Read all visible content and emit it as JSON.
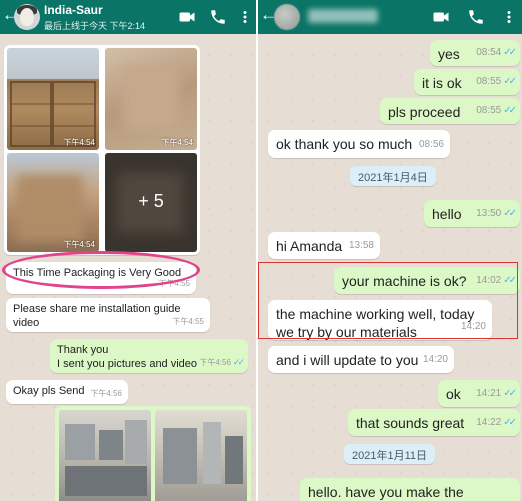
{
  "left_chat": {
    "header": {
      "back_icon": "←",
      "contact_name": "India-Saur",
      "status": "最后上线于今天 下午2:14"
    },
    "photo_album_1": {
      "times": [
        "下午4:54",
        "下午4:54",
        "下午4:54"
      ],
      "more_count": "+ 5"
    },
    "messages": [
      {
        "text": "This Time Packaging is Very Good",
        "time": "下午4:55"
      },
      {
        "text": "Please share me installation guide video",
        "time": "下午4:55"
      },
      {
        "line1": "Thank you",
        "line2": "I sent you pictures and video",
        "time": "下午4:56"
      },
      {
        "text": "Okay pls Send",
        "time": "下午4:56"
      }
    ]
  },
  "right_chat": {
    "header": {
      "back_icon": "←"
    },
    "messages": [
      {
        "text": "yes",
        "time": "08:54"
      },
      {
        "text": "it is ok",
        "time": "08:55"
      },
      {
        "text": "pls proceed",
        "time": "08:55"
      },
      {
        "text": "ok thank you so much",
        "time": "08:56"
      },
      {
        "date": "2021年1月4日"
      },
      {
        "text": "hello",
        "time": "13:50"
      },
      {
        "text": "hi Amanda",
        "time": "13:58"
      },
      {
        "text": "your machine is ok?",
        "time": "14:02"
      },
      {
        "line1": "the machine working well, today",
        "line2": "we try by our materials",
        "time": "14:20"
      },
      {
        "text": "and i will update to you",
        "time": "14:20"
      },
      {
        "text": "ok",
        "time": "14:21"
      },
      {
        "text": "that sounds great",
        "time": "14:22"
      },
      {
        "date": "2021年1月11日"
      },
      {
        "text": "hello. have you make the"
      }
    ]
  },
  "colors": {
    "header": "#0a7466",
    "incoming": "#ffffff",
    "outgoing": "#dcf8c6",
    "read_tick": "#4fb6ec",
    "wallpaper": "#e6ddd4",
    "ellipse": "#e0448a",
    "box": "#d9352f"
  },
  "icons": [
    "back-arrow-icon",
    "video-call-icon",
    "phone-icon",
    "more-menu-icon",
    "double-check-icon"
  ]
}
